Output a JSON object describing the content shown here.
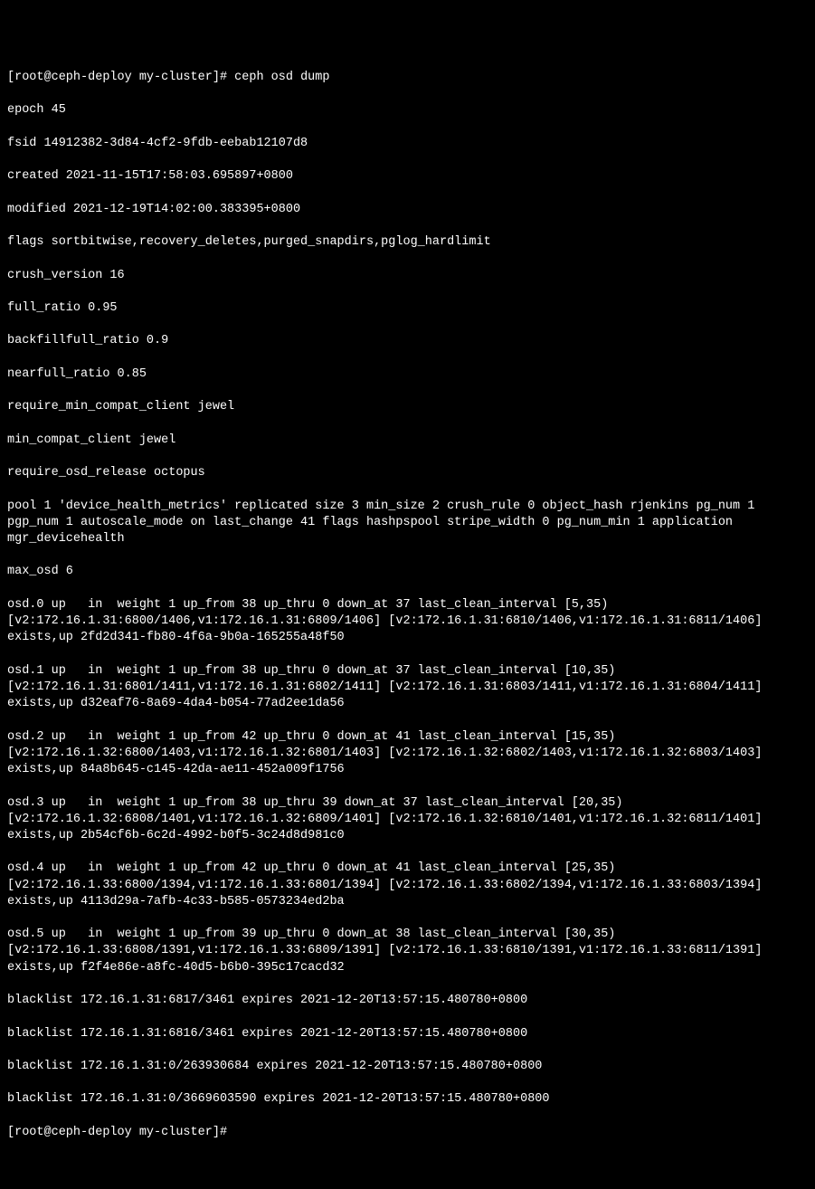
{
  "terminal": {
    "prompt1": "[root@ceph-deploy my-cluster]# ",
    "command": "ceph osd dump",
    "prompt2": "[root@ceph-deploy my-cluster]#",
    "lines": {
      "epoch": "epoch 45",
      "fsid": "fsid 14912382-3d84-4cf2-9fdb-eebab12107d8",
      "created": "created 2021-11-15T17:58:03.695897+0800",
      "modified": "modified 2021-12-19T14:02:00.383395+0800",
      "flags": "flags sortbitwise,recovery_deletes,purged_snapdirs,pglog_hardlimit",
      "crush_version": "crush_version 16",
      "full_ratio": "full_ratio 0.95",
      "backfillfull_ratio": "backfillfull_ratio 0.9",
      "nearfull_ratio": "nearfull_ratio 0.85",
      "require_min_compat_client": "require_min_compat_client jewel",
      "min_compat_client": "min_compat_client jewel",
      "require_osd_release": "require_osd_release octopus",
      "pool": "pool 1 'device_health_metrics' replicated size 3 min_size 2 crush_rule 0 object_hash rjenkins pg_num 1 pgp_num 1 autoscale_mode on last_change 41 flags hashpspool stripe_width 0 pg_num_min 1 application mgr_devicehealth",
      "max_osd": "max_osd 6",
      "osd0": "osd.0 up   in  weight 1 up_from 38 up_thru 0 down_at 37 last_clean_interval [5,35) [v2:172.16.1.31:6800/1406,v1:172.16.1.31:6809/1406] [v2:172.16.1.31:6810/1406,v1:172.16.1.31:6811/1406] exists,up 2fd2d341-fb80-4f6a-9b0a-165255a48f50",
      "osd1": "osd.1 up   in  weight 1 up_from 38 up_thru 0 down_at 37 last_clean_interval [10,35) [v2:172.16.1.31:6801/1411,v1:172.16.1.31:6802/1411] [v2:172.16.1.31:6803/1411,v1:172.16.1.31:6804/1411] exists,up d32eaf76-8a69-4da4-b054-77ad2ee1da56",
      "osd2": "osd.2 up   in  weight 1 up_from 42 up_thru 0 down_at 41 last_clean_interval [15,35) [v2:172.16.1.32:6800/1403,v1:172.16.1.32:6801/1403] [v2:172.16.1.32:6802/1403,v1:172.16.1.32:6803/1403] exists,up 84a8b645-c145-42da-ae11-452a009f1756",
      "osd3": "osd.3 up   in  weight 1 up_from 38 up_thru 39 down_at 37 last_clean_interval [20,35) [v2:172.16.1.32:6808/1401,v1:172.16.1.32:6809/1401] [v2:172.16.1.32:6810/1401,v1:172.16.1.32:6811/1401] exists,up 2b54cf6b-6c2d-4992-b0f5-3c24d8d981c0",
      "osd4": "osd.4 up   in  weight 1 up_from 42 up_thru 0 down_at 41 last_clean_interval [25,35) [v2:172.16.1.33:6800/1394,v1:172.16.1.33:6801/1394] [v2:172.16.1.33:6802/1394,v1:172.16.1.33:6803/1394] exists,up 4113d29a-7afb-4c33-b585-0573234ed2ba",
      "osd5": "osd.5 up   in  weight 1 up_from 39 up_thru 0 down_at 38 last_clean_interval [30,35) [v2:172.16.1.33:6808/1391,v1:172.16.1.33:6809/1391] [v2:172.16.1.33:6810/1391,v1:172.16.1.33:6811/1391] exists,up f2f4e86e-a8fc-40d5-b6b0-395c17cacd32",
      "blacklist1": "blacklist 172.16.1.31:6817/3461 expires 2021-12-20T13:57:15.480780+0800",
      "blacklist2": "blacklist 172.16.1.31:6816/3461 expires 2021-12-20T13:57:15.480780+0800",
      "blacklist3": "blacklist 172.16.1.31:0/263930684 expires 2021-12-20T13:57:15.480780+0800",
      "blacklist4": "blacklist 172.16.1.31:0/3669603590 expires 2021-12-20T13:57:15.480780+0800"
    }
  }
}
